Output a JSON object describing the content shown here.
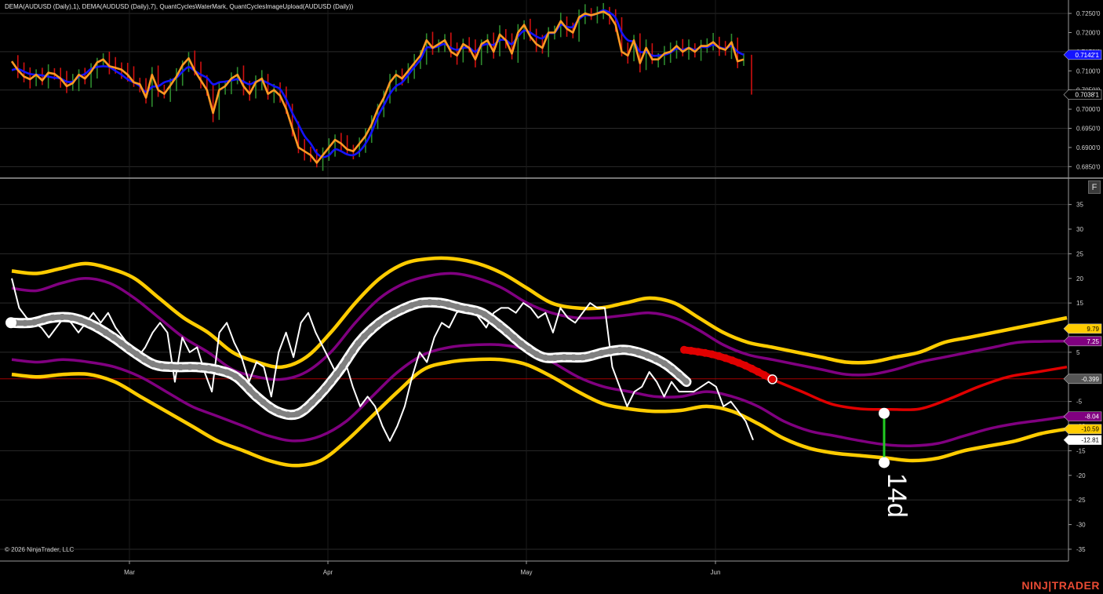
{
  "indicator_title": "DEMA(AUDUSD (Daily),1), DEMA(AUDUSD (Daily),7), QuantCyclesWaterMark, QuantCyclesImageUpload(AUDUSD (Daily))",
  "copyright": "© 2026 NinjaTrader, LLC",
  "brand": {
    "left": "NINJ",
    "right": "TRADER"
  },
  "panel_button": "F",
  "colors": {
    "background": "#000000",
    "grid": "#2a2a2a",
    "dema_fast": "#ff9922",
    "dema_slow": "#1414ff",
    "bar_up": "#2e8b2e",
    "bar_down": "#d01010",
    "osc_raw": "#ffffff",
    "cycle": "#808080",
    "cycle_projection": "#e00000",
    "band_inner": "#800080",
    "band_outer": "#ffcc00",
    "zero_line": "#a00000",
    "marker_line": "#22cc22"
  },
  "chart_data": [
    {
      "type": "line",
      "title": "",
      "x": [
        "Mar",
        "Apr",
        "May",
        "Jun"
      ],
      "ylim": [
        0.684,
        0.728
      ],
      "y_ticks": [
        "0.7250'0",
        "0.7200'0",
        "0.7150'0",
        "0.7100'0",
        "0.7050'0",
        "0.7000'0",
        "0.6950'0",
        "0.6900'0",
        "0.6850'0"
      ],
      "series": [
        {
          "name": "DEMA(AUDUSD (Daily),1)",
          "values": [
            0.7125,
            0.7102,
            0.7085,
            0.7078,
            0.709,
            0.7075,
            0.7095,
            0.7092,
            0.708,
            0.706,
            0.7068,
            0.709,
            0.708,
            0.7098,
            0.7122,
            0.713,
            0.7112,
            0.7108,
            0.7103,
            0.709,
            0.707,
            0.7065,
            0.703,
            0.709,
            0.705,
            0.704,
            0.7062,
            0.7085,
            0.7115,
            0.7133,
            0.71,
            0.7075,
            0.705,
            0.699,
            0.705,
            0.706,
            0.708,
            0.709,
            0.706,
            0.704,
            0.707,
            0.708,
            0.704,
            0.705,
            0.7035,
            0.7,
            0.695,
            0.69,
            0.689,
            0.688,
            0.686,
            0.688,
            0.69,
            0.692,
            0.691,
            0.6895,
            0.689,
            0.691,
            0.693,
            0.696,
            0.7,
            0.703,
            0.707,
            0.709,
            0.708,
            0.71,
            0.712,
            0.714,
            0.718,
            0.716,
            0.717,
            0.718,
            0.715,
            0.714,
            0.717,
            0.716,
            0.713,
            0.717,
            0.718,
            0.715,
            0.7195,
            0.718,
            0.7145,
            0.72,
            0.722,
            0.719,
            0.717,
            0.716,
            0.72,
            0.72,
            0.723,
            0.721,
            0.72,
            0.724,
            0.725,
            0.7245,
            0.725,
            0.7255,
            0.7245,
            0.722,
            0.715,
            0.714,
            0.718,
            0.712,
            0.716,
            0.713,
            0.713,
            0.7145,
            0.715,
            0.7165,
            0.715,
            0.716,
            0.715,
            0.7165,
            0.7165,
            0.7175,
            0.716,
            0.7155,
            0.7175,
            0.7125,
            0.713
          ]
        },
        {
          "name": "DEMA(AUDUSD (Daily),7)",
          "values": [
            0.7102,
            0.7105,
            0.7098,
            0.7092,
            0.709,
            0.7088,
            0.7085,
            0.7082,
            0.708,
            0.7072,
            0.7072,
            0.7085,
            0.7092,
            0.7105,
            0.711,
            0.7112,
            0.711,
            0.71,
            0.709,
            0.7078,
            0.707,
            0.706,
            0.7045,
            0.7058,
            0.706,
            0.707,
            0.7075,
            0.7082,
            0.7098,
            0.711,
            0.71,
            0.709,
            0.7082,
            0.7065,
            0.707,
            0.7072,
            0.7075,
            0.7078,
            0.7072,
            0.7065,
            0.7072,
            0.7075,
            0.7068,
            0.706,
            0.7052,
            0.7025,
            0.699,
            0.696,
            0.693,
            0.691,
            0.6885,
            0.6875,
            0.688,
            0.6895,
            0.689,
            0.6882,
            0.688,
            0.689,
            0.691,
            0.694,
            0.698,
            0.701,
            0.704,
            0.706,
            0.707,
            0.709,
            0.711,
            0.713,
            0.716,
            0.716,
            0.7165,
            0.717,
            0.716,
            0.7155,
            0.716,
            0.716,
            0.715,
            0.7165,
            0.717,
            0.7168,
            0.718,
            0.718,
            0.717,
            0.719,
            0.7205,
            0.72,
            0.719,
            0.7185,
            0.7198,
            0.72,
            0.722,
            0.7215,
            0.7215,
            0.7235,
            0.7245,
            0.7245,
            0.725,
            0.7258,
            0.7252,
            0.7238,
            0.72,
            0.718,
            0.7175,
            0.715,
            0.715,
            0.714,
            0.714,
            0.7142,
            0.7148,
            0.7158,
            0.7155,
            0.716,
            0.7155,
            0.7162,
            0.7162,
            0.7168,
            0.7162,
            0.7158,
            0.7165,
            0.715,
            0.7142
          ]
        }
      ],
      "price_badges": [
        {
          "value": 0.7142,
          "label": "0.7142'1",
          "bg": "#1414ff",
          "fg": "#ffffff"
        },
        {
          "value": 0.7038,
          "label": "0.7038'1",
          "bg": "#000000",
          "fg": "#ffffff"
        }
      ]
    },
    {
      "type": "line",
      "title": "",
      "x": [
        "Mar",
        "Apr",
        "May",
        "Jun"
      ],
      "ylim": [
        -37,
        39
      ],
      "y_ticks": [
        "35",
        "30",
        "25",
        "20",
        "15",
        "10",
        "5",
        "0",
        "-5",
        "-10",
        "-15",
        "-20",
        "-25",
        "-30",
        "-35"
      ],
      "zero_value": -0.399,
      "series": [
        {
          "name": "Outer Upper Band",
          "values": [
            21.5,
            21,
            22,
            23,
            22,
            20,
            16,
            12,
            9,
            5,
            3,
            2,
            4,
            9,
            15,
            20,
            23,
            24,
            24,
            23,
            21,
            18,
            15,
            14,
            14,
            15,
            16,
            15,
            12,
            9,
            7,
            6,
            5,
            4,
            3,
            3,
            4,
            5,
            7,
            8,
            9,
            10,
            11,
            12
          ]
        },
        {
          "name": "Inner Upper Band",
          "values": [
            18,
            17.5,
            19,
            20,
            19,
            16,
            12,
            8,
            5,
            1.5,
            0,
            -0.5,
            1,
            5,
            11,
            16,
            19,
            20.5,
            21,
            20,
            18,
            15,
            13,
            12,
            12,
            12.5,
            13,
            12,
            9.5,
            6.5,
            4.5,
            3.5,
            2.5,
            1.5,
            0.5,
            0.5,
            1.5,
            3,
            4,
            5,
            6,
            7,
            7.2,
            7.25
          ]
        },
        {
          "name": "Cycle",
          "values": [
            11,
            11,
            12,
            12,
            10.5,
            8,
            5,
            2.5,
            2,
            2,
            1.5,
            0,
            -4,
            -7,
            -7.5,
            -4,
            1,
            7,
            11,
            13.5,
            15,
            15,
            14,
            13,
            10,
            6.5,
            4,
            4,
            4,
            5,
            5.5,
            4.5,
            2.5,
            -1
          ]
        },
        {
          "name": "Cycle Projection",
          "values": [
            5.5,
            4.5,
            2.5,
            -0.5,
            -3,
            -5.5,
            -6.5,
            -6.6,
            -6.5,
            -4.5,
            -2,
            0,
            1,
            2
          ]
        },
        {
          "name": "Inner Lower Band",
          "values": [
            3.5,
            3,
            3.5,
            3,
            2,
            0,
            -3,
            -6,
            -8,
            -10,
            -12,
            -13,
            -12,
            -9,
            -4,
            1,
            4.5,
            6,
            6.5,
            6.5,
            5.5,
            3,
            0,
            -2,
            -3,
            -4,
            -4,
            -3,
            -4,
            -6,
            -9,
            -11,
            -12,
            -13,
            -13.8,
            -14,
            -13.5,
            -12,
            -10.5,
            -9.5,
            -8.8,
            -8.04
          ]
        },
        {
          "name": "Outer Lower Band",
          "values": [
            0.5,
            0,
            0.5,
            0.5,
            -1,
            -4,
            -7,
            -10,
            -13,
            -15,
            -17,
            -18,
            -17,
            -13,
            -8,
            -3,
            1.5,
            3,
            3.5,
            3.5,
            2.5,
            0,
            -3,
            -5.5,
            -6.5,
            -7,
            -6.8,
            -6,
            -7,
            -9.5,
            -12.5,
            -14.5,
            -15.5,
            -16,
            -16.5,
            -17,
            -16.5,
            -15,
            -14,
            -13,
            -11.5,
            -10.59
          ]
        },
        {
          "name": "Raw Oscillator",
          "values": [
            20,
            14,
            12,
            11,
            10,
            8,
            10,
            12,
            11,
            9,
            11,
            13,
            11,
            13,
            10,
            8,
            6,
            4,
            6,
            9,
            11,
            9,
            -1,
            8,
            5,
            6,
            1,
            -3,
            9,
            11,
            7,
            4,
            -1,
            3,
            2,
            -4,
            5,
            9,
            4,
            11,
            13,
            9,
            6,
            3,
            0,
            3,
            -2,
            -6,
            -4,
            -6,
            -10,
            -13,
            -10,
            -6,
            0,
            5,
            3,
            8,
            11,
            10,
            13,
            14,
            14,
            12,
            10,
            13,
            14,
            14,
            13,
            15,
            14,
            12,
            13,
            9,
            14,
            12,
            11,
            13,
            15,
            14,
            14,
            2,
            -2,
            -6,
            -3,
            -2,
            1,
            -1,
            -4,
            -1,
            -3,
            -3,
            -3,
            -2,
            -1,
            -2,
            -6,
            -5,
            -7,
            -9,
            -12.81
          ]
        }
      ],
      "value_badges": [
        {
          "value": 9.79,
          "label": "9.79",
          "bg": "#ffcc00",
          "fg": "#000000"
        },
        {
          "value": 7.25,
          "label": "7.25",
          "bg": "#800080",
          "fg": "#ffffff"
        },
        {
          "value": -0.399,
          "label": "-0.399",
          "bg": "#555555",
          "fg": "#ffffff"
        },
        {
          "value": -8.04,
          "label": "-8.04",
          "bg": "#800080",
          "fg": "#ffffff"
        },
        {
          "value": -10.59,
          "label": "-10.59",
          "bg": "#ffcc00",
          "fg": "#000000"
        },
        {
          "value": -12.81,
          "label": "-12.81",
          "bg": "#ffffff",
          "fg": "#000000"
        }
      ],
      "annotation": {
        "label": "14d",
        "top_value": -7.4,
        "bottom_value": -17.4
      }
    }
  ]
}
